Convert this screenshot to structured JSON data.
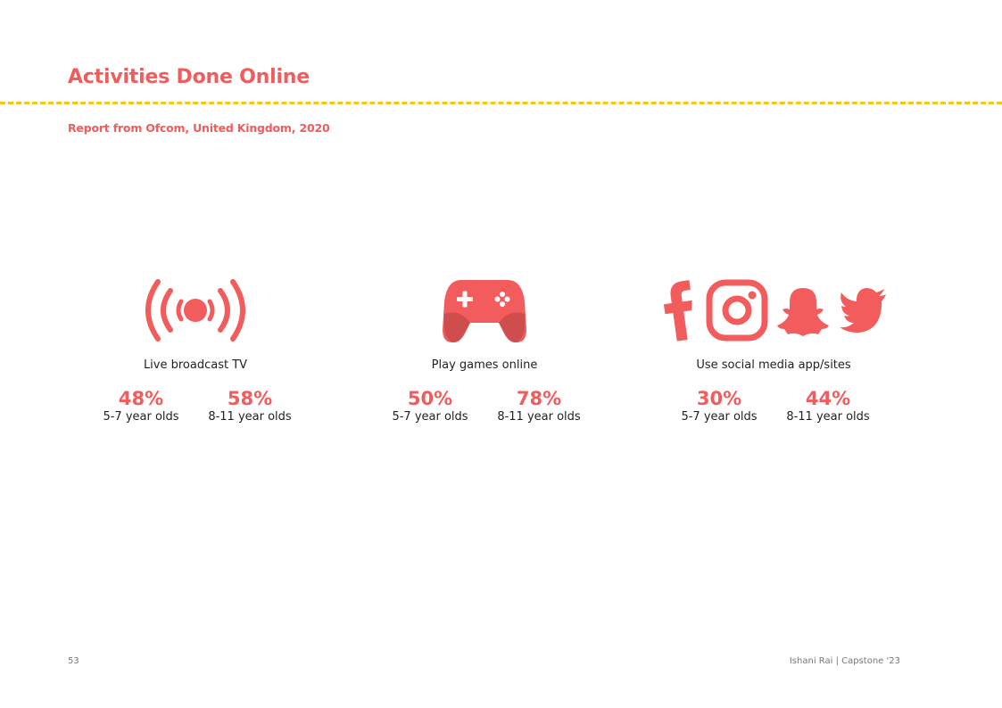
{
  "page": {
    "title": "Activities Done Online",
    "subtitle": "Report from Ofcom, United Kingdom, 2020",
    "page_number": "53",
    "footer_credit": "Ishani Rai | Capstone '23"
  },
  "colors": {
    "accent": "#F25C5C",
    "divider": "#F5C518",
    "text": "#222222"
  },
  "activities": [
    {
      "icon": "broadcast-icon",
      "label": "Live broadcast TV",
      "stats": [
        {
          "pct": "48%",
          "age": "5-7 year olds"
        },
        {
          "pct": "58%",
          "age": "8-11 year olds"
        }
      ]
    },
    {
      "icon": "gamepad-icon",
      "label": "Play games online",
      "stats": [
        {
          "pct": "50%",
          "age": "5-7 year olds"
        },
        {
          "pct": "78%",
          "age": "8-11 year olds"
        }
      ]
    },
    {
      "icons": [
        "facebook-icon",
        "instagram-icon",
        "snapchat-icon",
        "twitter-icon"
      ],
      "label": "Use social media app/sites",
      "stats": [
        {
          "pct": "30%",
          "age": "5-7 year olds"
        },
        {
          "pct": "44%",
          "age": "8-11 year olds"
        }
      ]
    }
  ]
}
